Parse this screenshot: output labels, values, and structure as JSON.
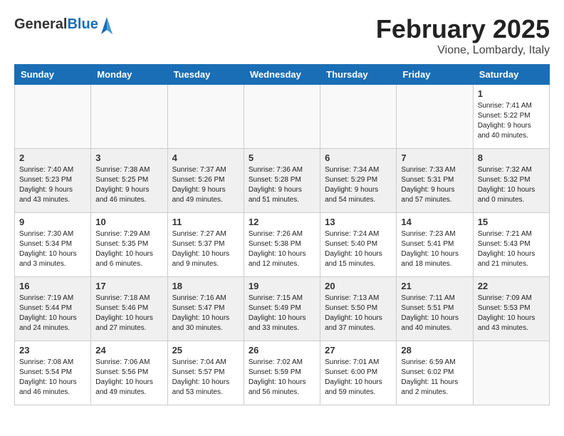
{
  "header": {
    "logo_general": "General",
    "logo_blue": "Blue",
    "month_title": "February 2025",
    "location": "Vione, Lombardy, Italy"
  },
  "days_of_week": [
    "Sunday",
    "Monday",
    "Tuesday",
    "Wednesday",
    "Thursday",
    "Friday",
    "Saturday"
  ],
  "weeks": [
    [
      {
        "day": "",
        "info": ""
      },
      {
        "day": "",
        "info": ""
      },
      {
        "day": "",
        "info": ""
      },
      {
        "day": "",
        "info": ""
      },
      {
        "day": "",
        "info": ""
      },
      {
        "day": "",
        "info": ""
      },
      {
        "day": "1",
        "info": "Sunrise: 7:41 AM\nSunset: 5:22 PM\nDaylight: 9 hours and 40 minutes."
      }
    ],
    [
      {
        "day": "2",
        "info": "Sunrise: 7:40 AM\nSunset: 5:23 PM\nDaylight: 9 hours and 43 minutes."
      },
      {
        "day": "3",
        "info": "Sunrise: 7:38 AM\nSunset: 5:25 PM\nDaylight: 9 hours and 46 minutes."
      },
      {
        "day": "4",
        "info": "Sunrise: 7:37 AM\nSunset: 5:26 PM\nDaylight: 9 hours and 49 minutes."
      },
      {
        "day": "5",
        "info": "Sunrise: 7:36 AM\nSunset: 5:28 PM\nDaylight: 9 hours and 51 minutes."
      },
      {
        "day": "6",
        "info": "Sunrise: 7:34 AM\nSunset: 5:29 PM\nDaylight: 9 hours and 54 minutes."
      },
      {
        "day": "7",
        "info": "Sunrise: 7:33 AM\nSunset: 5:31 PM\nDaylight: 9 hours and 57 minutes."
      },
      {
        "day": "8",
        "info": "Sunrise: 7:32 AM\nSunset: 5:32 PM\nDaylight: 10 hours and 0 minutes."
      }
    ],
    [
      {
        "day": "9",
        "info": "Sunrise: 7:30 AM\nSunset: 5:34 PM\nDaylight: 10 hours and 3 minutes."
      },
      {
        "day": "10",
        "info": "Sunrise: 7:29 AM\nSunset: 5:35 PM\nDaylight: 10 hours and 6 minutes."
      },
      {
        "day": "11",
        "info": "Sunrise: 7:27 AM\nSunset: 5:37 PM\nDaylight: 10 hours and 9 minutes."
      },
      {
        "day": "12",
        "info": "Sunrise: 7:26 AM\nSunset: 5:38 PM\nDaylight: 10 hours and 12 minutes."
      },
      {
        "day": "13",
        "info": "Sunrise: 7:24 AM\nSunset: 5:40 PM\nDaylight: 10 hours and 15 minutes."
      },
      {
        "day": "14",
        "info": "Sunrise: 7:23 AM\nSunset: 5:41 PM\nDaylight: 10 hours and 18 minutes."
      },
      {
        "day": "15",
        "info": "Sunrise: 7:21 AM\nSunset: 5:43 PM\nDaylight: 10 hours and 21 minutes."
      }
    ],
    [
      {
        "day": "16",
        "info": "Sunrise: 7:19 AM\nSunset: 5:44 PM\nDaylight: 10 hours and 24 minutes."
      },
      {
        "day": "17",
        "info": "Sunrise: 7:18 AM\nSunset: 5:46 PM\nDaylight: 10 hours and 27 minutes."
      },
      {
        "day": "18",
        "info": "Sunrise: 7:16 AM\nSunset: 5:47 PM\nDaylight: 10 hours and 30 minutes."
      },
      {
        "day": "19",
        "info": "Sunrise: 7:15 AM\nSunset: 5:49 PM\nDaylight: 10 hours and 33 minutes."
      },
      {
        "day": "20",
        "info": "Sunrise: 7:13 AM\nSunset: 5:50 PM\nDaylight: 10 hours and 37 minutes."
      },
      {
        "day": "21",
        "info": "Sunrise: 7:11 AM\nSunset: 5:51 PM\nDaylight: 10 hours and 40 minutes."
      },
      {
        "day": "22",
        "info": "Sunrise: 7:09 AM\nSunset: 5:53 PM\nDaylight: 10 hours and 43 minutes."
      }
    ],
    [
      {
        "day": "23",
        "info": "Sunrise: 7:08 AM\nSunset: 5:54 PM\nDaylight: 10 hours and 46 minutes."
      },
      {
        "day": "24",
        "info": "Sunrise: 7:06 AM\nSunset: 5:56 PM\nDaylight: 10 hours and 49 minutes."
      },
      {
        "day": "25",
        "info": "Sunrise: 7:04 AM\nSunset: 5:57 PM\nDaylight: 10 hours and 53 minutes."
      },
      {
        "day": "26",
        "info": "Sunrise: 7:02 AM\nSunset: 5:59 PM\nDaylight: 10 hours and 56 minutes."
      },
      {
        "day": "27",
        "info": "Sunrise: 7:01 AM\nSunset: 6:00 PM\nDaylight: 10 hours and 59 minutes."
      },
      {
        "day": "28",
        "info": "Sunrise: 6:59 AM\nSunset: 6:02 PM\nDaylight: 11 hours and 2 minutes."
      },
      {
        "day": "",
        "info": ""
      }
    ]
  ]
}
